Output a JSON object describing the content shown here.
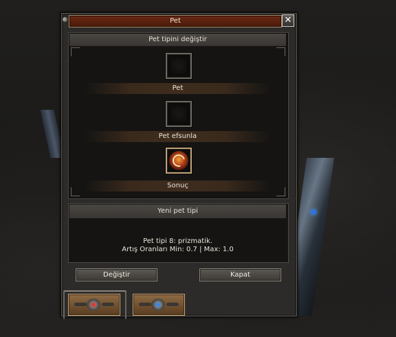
{
  "window": {
    "title": "Pet",
    "close_symbol": "✕"
  },
  "change_panel": {
    "heading": "Pet tipini değiştir",
    "slots": [
      {
        "label": "Pet",
        "icon": "empty-slot-icon"
      },
      {
        "label": "Pet efsunla",
        "icon": "empty-slot-icon"
      },
      {
        "label": "Sonuç",
        "icon": "pet-result-icon"
      }
    ]
  },
  "new_type_panel": {
    "heading": "Yeni pet tipi",
    "line1": "Pet tipi 8: prizmatik.",
    "line2": "Artış Oranları Min: 0.7 | Max: 1.0"
  },
  "buttons": {
    "change": "Değiştir",
    "close": "Kapat"
  },
  "tabs": [
    {
      "name": "tab-red-emblem",
      "icon": "red-gem-emblem-icon"
    },
    {
      "name": "tab-blue-emblem",
      "icon": "blue-gem-emblem-icon"
    }
  ]
}
